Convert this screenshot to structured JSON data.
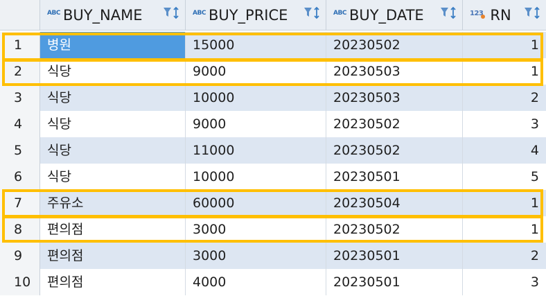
{
  "columns": [
    {
      "name": "BUY_NAME",
      "type_badge": "ABC",
      "icon": "text-type-icon"
    },
    {
      "name": "BUY_PRICE",
      "type_badge": "ABC",
      "icon": "text-type-icon"
    },
    {
      "name": "BUY_DATE",
      "type_badge": "ABC",
      "icon": "text-type-icon"
    },
    {
      "name": "RN",
      "type_badge": "123",
      "icon": "number-type-icon"
    }
  ],
  "rows": [
    {
      "num": "1",
      "name": "병원",
      "price": "15000",
      "date": "20230502",
      "rn": "1"
    },
    {
      "num": "2",
      "name": "식당",
      "price": "9000",
      "date": "20230503",
      "rn": "1"
    },
    {
      "num": "3",
      "name": "식당",
      "price": "10000",
      "date": "20230503",
      "rn": "2"
    },
    {
      "num": "4",
      "name": "식당",
      "price": "9000",
      "date": "20230502",
      "rn": "3"
    },
    {
      "num": "5",
      "name": "식당",
      "price": "11000",
      "date": "20230502",
      "rn": "4"
    },
    {
      "num": "6",
      "name": "식당",
      "price": "10000",
      "date": "20230501",
      "rn": "5"
    },
    {
      "num": "7",
      "name": "주유소",
      "price": "60000",
      "date": "20230504",
      "rn": "1"
    },
    {
      "num": "8",
      "name": "편의점",
      "price": "3000",
      "date": "20230502",
      "rn": "1"
    },
    {
      "num": "9",
      "name": "편의점",
      "price": "3000",
      "date": "20230501",
      "rn": "2"
    },
    {
      "num": "10",
      "name": "편의점",
      "price": "4000",
      "date": "20230501",
      "rn": "3"
    }
  ],
  "selected_row": 1,
  "highlighted_rows": [
    "1",
    "2",
    "7",
    "8"
  ],
  "colors": {
    "highlight": "#ffbf00",
    "selection": "#4f9be0",
    "band": "#dde6f2"
  }
}
